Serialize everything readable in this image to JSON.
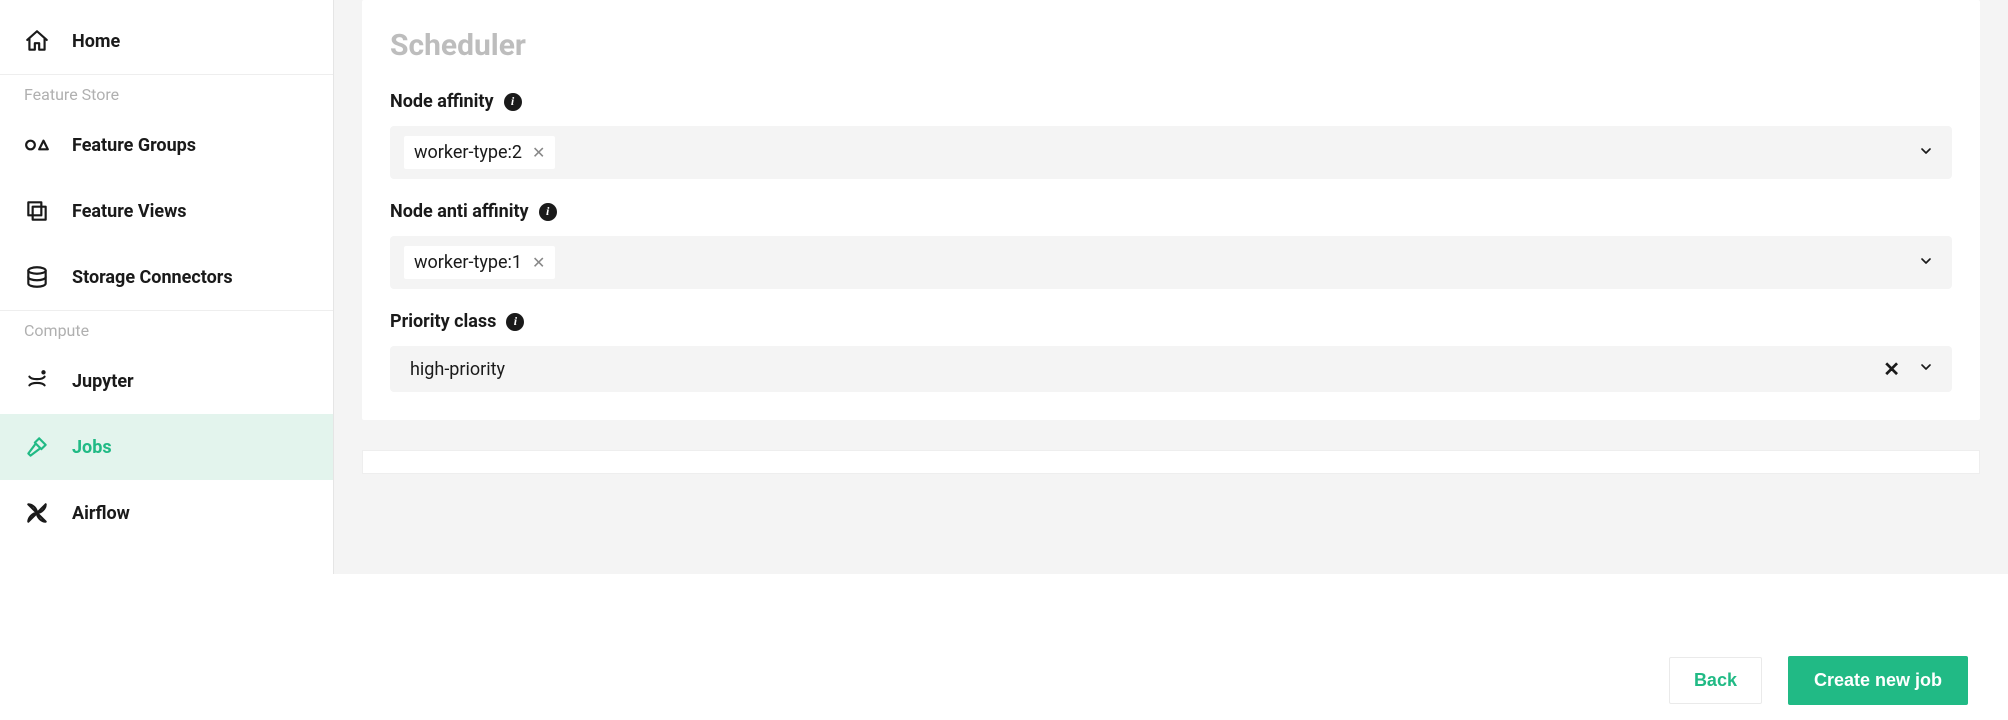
{
  "sidebar": {
    "items": [
      {
        "label": "Home"
      },
      {
        "label": "Feature Groups"
      },
      {
        "label": "Feature Views"
      },
      {
        "label": "Storage Connectors"
      },
      {
        "label": "Jupyter"
      },
      {
        "label": "Jobs"
      },
      {
        "label": "Airflow"
      }
    ],
    "sections": {
      "feature_store": "Feature Store",
      "compute": "Compute"
    }
  },
  "scheduler": {
    "title": "Scheduler",
    "node_affinity": {
      "label": "Node affinity",
      "chip": "worker-type:2"
    },
    "node_anti_affinity": {
      "label": "Node anti affinity",
      "chip": "worker-type:1"
    },
    "priority_class": {
      "label": "Priority class",
      "value": "high-priority"
    }
  },
  "footer": {
    "back": "Back",
    "create": "Create new job"
  }
}
